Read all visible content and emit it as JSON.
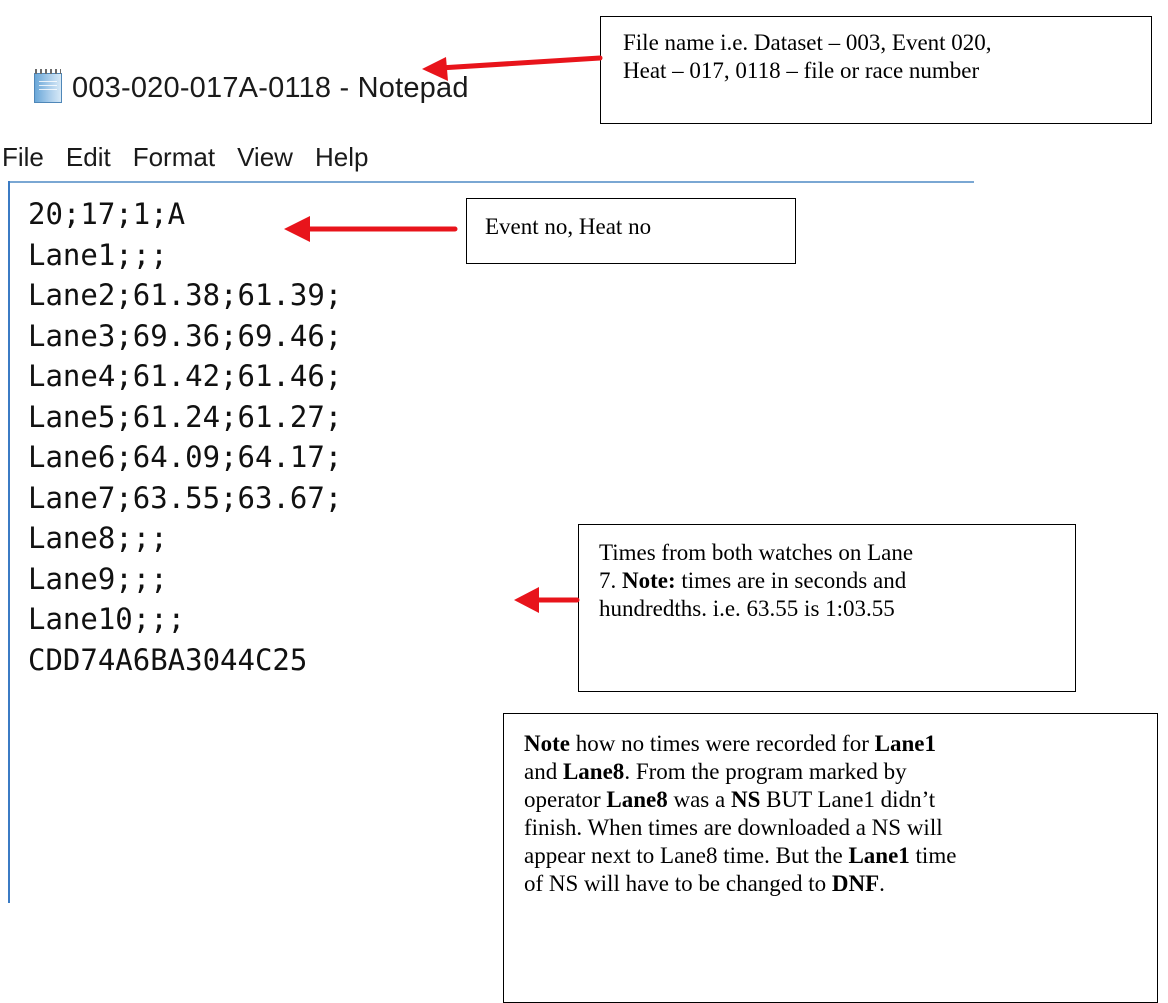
{
  "window": {
    "title": "003-020-017A-0118 - Notepad",
    "icon": "notepad-icon"
  },
  "menu": {
    "items": [
      "File",
      "Edit",
      "Format",
      "View",
      "Help"
    ]
  },
  "editor": {
    "lines": [
      "20;17;1;A",
      "Lane1;;;",
      "Lane2;61.38;61.39;",
      "Lane3;69.36;69.46;",
      "Lane4;61.42;61.46;",
      "Lane5;61.24;61.27;",
      "Lane6;64.09;64.17;",
      "Lane7;63.55;63.67;",
      "Lane8;;;",
      "Lane9;;;",
      "Lane10;;;",
      "CDD74A6BA3044C25"
    ]
  },
  "annotations": {
    "filename": {
      "line1": "File name i.e. Dataset – 003, Event 020,",
      "line2": "Heat – 017, 0118 – file or race number"
    },
    "event": "Event no, Heat no",
    "lane7": {
      "line1": "Times from both watches on Lane",
      "line2_num": "7. ",
      "line2_bold": "Note:",
      "line2_rest": " times are in seconds and",
      "line3": "hundredths. i.e. 63.55 is 1:03.55"
    },
    "note": {
      "l1_bold1": "Note",
      "l1_text": " how no times were recorded for ",
      "l1_bold2": "Lane1",
      "l2_text1": "and ",
      "l2_bold": "Lane8",
      "l2_text2": ". From the program marked by",
      "l3_text": "operator ",
      "l3_bold1": "Lane8",
      "l3_mid": " was a ",
      "l3_bold2": "NS",
      "l3_end": " BUT Lane1 didn’t",
      "l4": "finish. When times are downloaded a NS will",
      "l5": "appear next to Lane8 time. But the ",
      "l5_bold": "Lane1",
      "l5_end": " time",
      "l6_text": "of NS will have to be changed to ",
      "l6_bold": "DNF",
      "l6_end": "."
    }
  },
  "colors": {
    "arrow": "#e8141b",
    "editor_border": "#3b7bc4"
  }
}
